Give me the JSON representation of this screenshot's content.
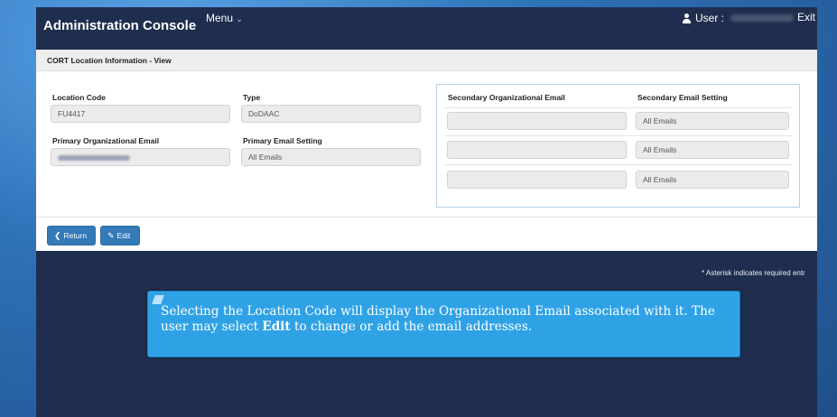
{
  "header": {
    "brand": "Administration Console",
    "menu_label": "Menu",
    "menu_caret": "⌄",
    "user_label": "User :",
    "exit_label": "Exit"
  },
  "panel": {
    "title": "CORT Location Information - View",
    "location_code_label": "Location Code",
    "location_code_value": "FU4417",
    "type_label": "Type",
    "type_value": "DoDAAC",
    "primary_email_label": "Primary Organizational Email",
    "primary_email_setting_label": "Primary Email Setting",
    "primary_email_setting_value": "All Emails",
    "secondary_email_label": "Secondary Organizational Email",
    "secondary_setting_label": "Secondary Email Setting",
    "secondary_rows": [
      {
        "email": "",
        "setting": "All Emails"
      },
      {
        "email": "",
        "setting": "All Emails"
      },
      {
        "email": "",
        "setting": "All Emails"
      }
    ]
  },
  "footer": {
    "return_label": "Return",
    "edit_label": "Edit"
  },
  "asterisk_note": "* Asterisk indicates required entr",
  "callout": {
    "text_before": "Selecting the Location Code will display the Organizational Email associated with it.  The user may select ",
    "bold": "Edit",
    "text_after": " to change or add the email addresses."
  }
}
